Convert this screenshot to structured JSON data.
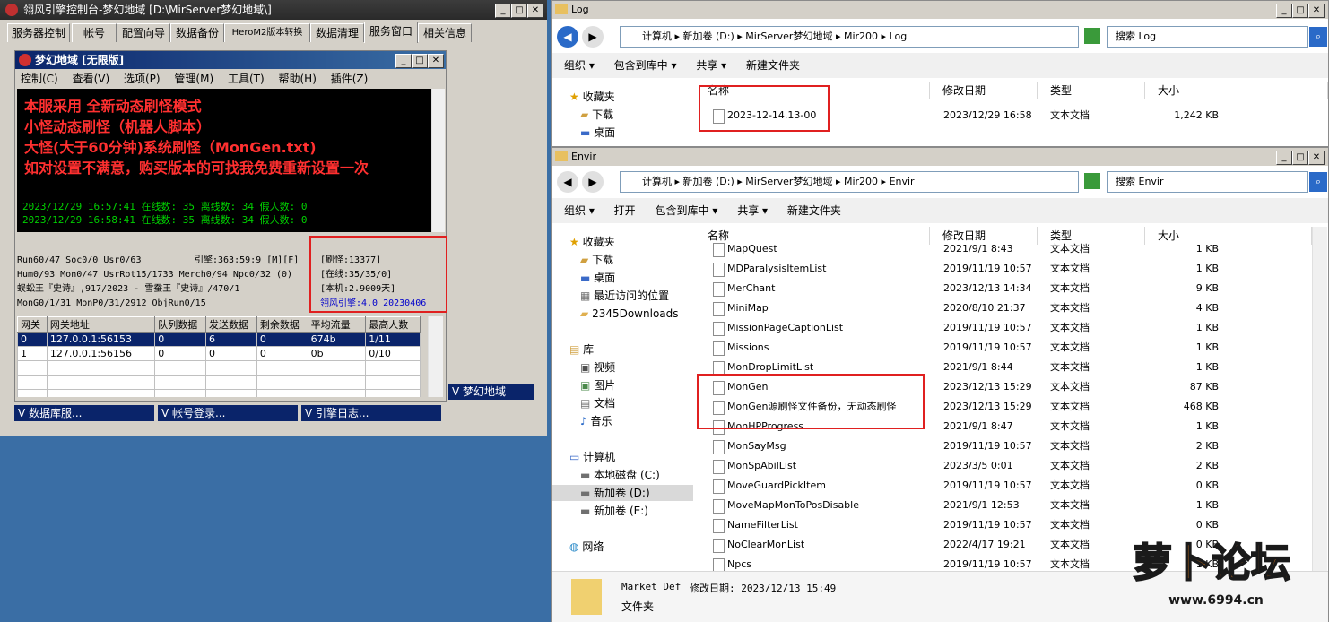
{
  "console": {
    "title": "翎风引擎控制台-梦幻地域 [D:\\MirServer梦幻地域\\]",
    "tabs": [
      "服务器控制",
      "帐号",
      "配置向导",
      "数据备份",
      "HeroM2版本转换",
      "数据清理",
      "服务窗口",
      "相关信息"
    ],
    "inner_title": "梦幻地域 [无限版]",
    "menu": [
      "控制(C)",
      "查看(V)",
      "选项(P)",
      "管理(M)",
      "工具(T)",
      "帮助(H)",
      "插件(Z)"
    ],
    "notes": [
      "本服采用 全新动态刷怪模式",
      "小怪动态刷怪（机器人脚本）",
      "大怪(大于60分钟)系统刷怪（MonGen.txt)",
      "如对设置不满意，购买版本的可找我免费重新设置一次"
    ],
    "logs": [
      "2023/12/29 16:57:41 在线数: 35 离线数: 34 假人数: 0",
      "2023/12/29 16:58:41 在线数: 35 离线数: 34 假人数: 0"
    ],
    "stats_left": [
      "Run60/47 Soc0/0 Usr0/63",
      "Hum0/93 Mon0/47 UsrRot15/1733 Merch0/94 Npc0/32 (0)",
      "蜈蚣王『史诗』,917/2023 - 雪蚕王『史诗』/470/1",
      "MonG0/1/31 MonP0/31/2912 ObjRun0/15"
    ],
    "engine": "引擎:363:59:9 [M][F]",
    "stats_right": [
      "[刷怪:13377]",
      "[在线:35/35/0]",
      "[本机:2.9009天]"
    ],
    "version_link": "翎风引擎:4.0 20230406",
    "gate_headers": [
      "网关",
      "网关地址",
      "队列数据",
      "发送数据",
      "剩余数据",
      "平均流量",
      "最高人数"
    ],
    "gate_rows": [
      [
        "0",
        "127.0.0.1:56153",
        "0",
        "6",
        "0",
        "674b",
        "1/11"
      ],
      [
        "1",
        "127.0.0.1:56156",
        "0",
        "0",
        "0",
        "0b",
        "0/10"
      ]
    ],
    "task_buttons": [
      "数据库服...",
      "帐号登录...",
      "引擎日志..."
    ],
    "side_label": "梦幻地域"
  },
  "log_window": {
    "title": "Log",
    "address": [
      "计算机",
      "新加卷 (D:)",
      "MirServer梦幻地域",
      "Mir200",
      "Log"
    ],
    "search_placeholder": "搜索 Log",
    "toolbar": [
      "组织 ▾",
      "包含到库中 ▾",
      "共享 ▾",
      "新建文件夹"
    ],
    "nav": [
      "收藏夹",
      "下载",
      "桌面"
    ],
    "columns": [
      "名称",
      "修改日期",
      "类型",
      "大小"
    ],
    "files": [
      [
        "2023-12-14.13-00",
        "2023/12/29 16:58",
        "文本文档",
        "1,242 KB"
      ]
    ]
  },
  "envir_window": {
    "title": "Envir",
    "address": [
      "计算机",
      "新加卷 (D:)",
      "MirServer梦幻地域",
      "Mir200",
      "Envir"
    ],
    "search_placeholder": "搜索 Envir",
    "toolbar": [
      "组织 ▾",
      "打开",
      "包含到库中 ▾",
      "共享 ▾",
      "新建文件夹"
    ],
    "nav": [
      "收藏夹",
      "下载",
      "桌面",
      "最近访问的位置",
      "2345Downloads",
      "库",
      "视频",
      "图片",
      "文档",
      "音乐",
      "计算机",
      "本地磁盘 (C:)",
      "新加卷 (D:)",
      "新加卷 (E:)",
      "网络"
    ],
    "columns": [
      "名称",
      "修改日期",
      "类型",
      "大小"
    ],
    "files": [
      [
        "MapQuest",
        "2021/9/1 8:43",
        "文本文档",
        "1 KB"
      ],
      [
        "MDParalysisItemList",
        "2019/11/19 10:57",
        "文本文档",
        "1 KB"
      ],
      [
        "MerChant",
        "2023/12/13 14:34",
        "文本文档",
        "9 KB"
      ],
      [
        "MiniMap",
        "2020/8/10 21:37",
        "文本文档",
        "4 KB"
      ],
      [
        "MissionPageCaptionList",
        "2019/11/19 10:57",
        "文本文档",
        "1 KB"
      ],
      [
        "Missions",
        "2019/11/19 10:57",
        "文本文档",
        "1 KB"
      ],
      [
        "MonDropLimitList",
        "2021/9/1 8:44",
        "文本文档",
        "1 KB"
      ],
      [
        "MonGen",
        "2023/12/13 15:29",
        "文本文档",
        "87 KB"
      ],
      [
        "MonGen源刷怪文件备份，无动态刷怪",
        "2023/12/13 15:29",
        "文本文档",
        "468 KB"
      ],
      [
        "MonHPProgress",
        "2021/9/1 8:47",
        "文本文档",
        "1 KB"
      ],
      [
        "MonSayMsg",
        "2019/11/19 10:57",
        "文本文档",
        "2 KB"
      ],
      [
        "MonSpAbilList",
        "2023/3/5 0:01",
        "文本文档",
        "2 KB"
      ],
      [
        "MoveGuardPickItem",
        "2019/11/19 10:57",
        "文本文档",
        "0 KB"
      ],
      [
        "MoveMapMonToPosDisable",
        "2021/9/1 12:53",
        "文本文档",
        "1 KB"
      ],
      [
        "NameFilterList",
        "2019/11/19 10:57",
        "文本文档",
        "0 KB"
      ],
      [
        "NoClearMonList",
        "2022/4/17 19:21",
        "文本文档",
        "0 KB"
      ],
      [
        "Npcs",
        "2019/11/19 10:57",
        "文本文档",
        "1 KB"
      ]
    ],
    "details": {
      "name": "Market_Def",
      "modified": "修改日期: 2023/12/13 15:49",
      "type": "文件夹"
    }
  },
  "watermark": {
    "brand": "萝卜论坛",
    "url": "www.6994.cn"
  }
}
